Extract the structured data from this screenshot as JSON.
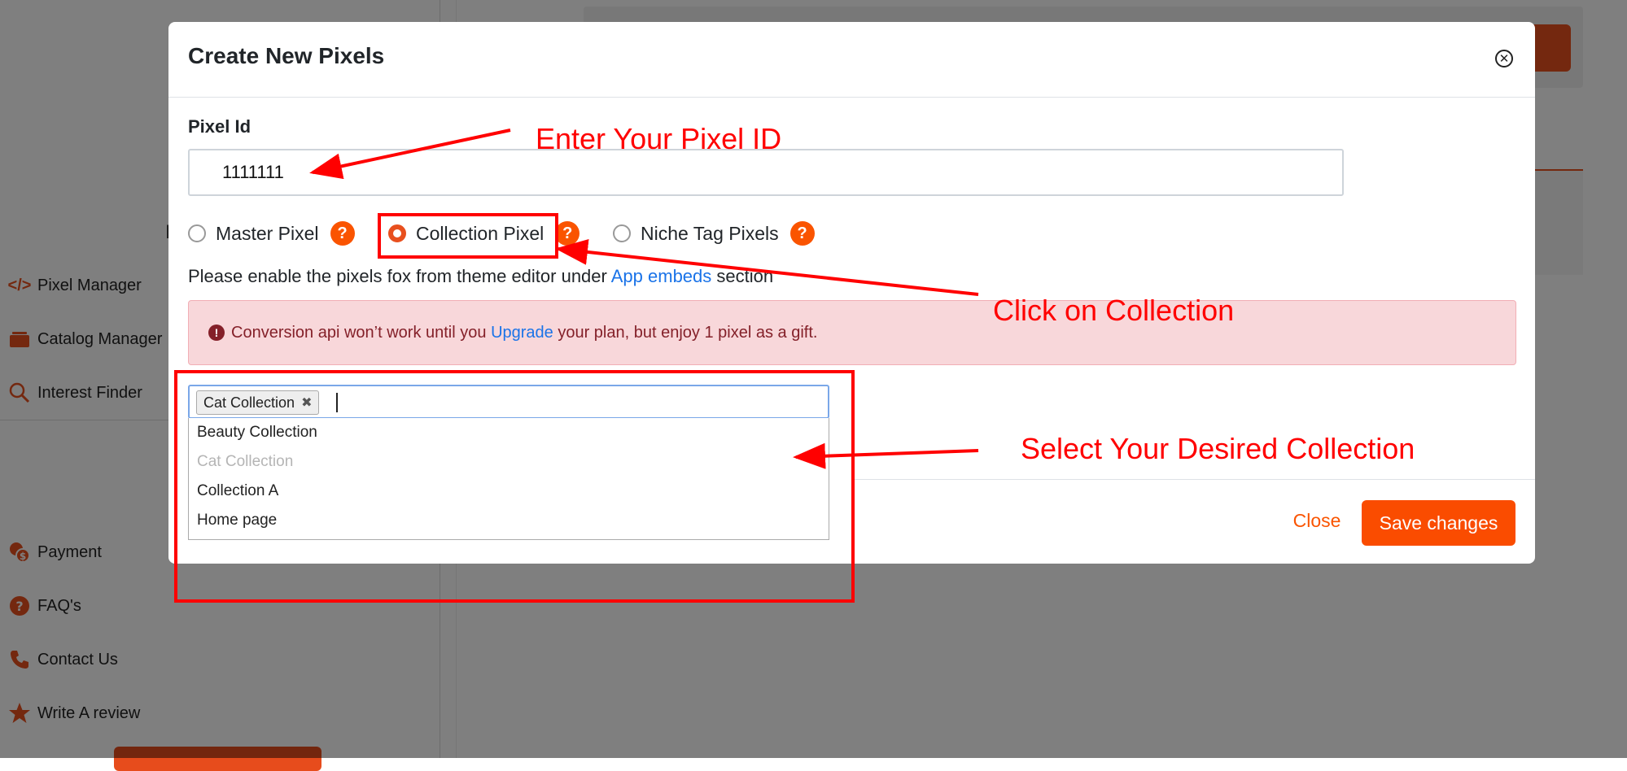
{
  "sidebar": {
    "stub": "I",
    "items": [
      {
        "label": "Pixel Manager",
        "icon": "code-icon"
      },
      {
        "label": "Catalog Manager",
        "icon": "catalog-icon"
      },
      {
        "label": "Interest Finder",
        "icon": "search-icon"
      },
      {
        "label": "Payment",
        "icon": "payment-icon"
      },
      {
        "label": "FAQ's",
        "icon": "help-icon"
      },
      {
        "label": "Contact Us",
        "icon": "phone-icon"
      },
      {
        "label": "Write A review",
        "icon": "star-icon"
      }
    ]
  },
  "modal": {
    "title": "Create New Pixels",
    "pixel_id_label": "Pixel Id",
    "pixel_id_value": "1111111",
    "radios": [
      {
        "label": "Master Pixel",
        "checked": false
      },
      {
        "label": "Collection Pixel",
        "checked": true
      },
      {
        "label": "Niche Tag Pixels",
        "checked": false
      }
    ],
    "help_glyph": "?",
    "note": {
      "before": "Please enable the pixels fox from theme editor under ",
      "link": "App embeds",
      "after": " section"
    },
    "alert": {
      "icon": "!",
      "before": "Conversion api won’t work until you ",
      "link": "Upgrade",
      "after": " your plan, but enjoy 1 pixel as a gift."
    },
    "select": {
      "selected_tag": "Cat Collection",
      "remove_glyph": "✖",
      "options": [
        {
          "label": "Beauty Collection",
          "disabled": false
        },
        {
          "label": "Cat Collection",
          "disabled": true
        },
        {
          "label": "Collection A",
          "disabled": false
        },
        {
          "label": "Home page",
          "disabled": false
        }
      ]
    },
    "close_label": "Close",
    "save_label": "Save changes",
    "close_glyph": "✕"
  },
  "annotations": {
    "enter_id": "Enter Your Pixel ID",
    "click_collection": "Click on Collection",
    "select_collection": "Select Your Desired Collection"
  },
  "colors": {
    "accent": "#fa4c00",
    "annotation": "#ff0000",
    "link": "#1a73e8",
    "alert_bg": "#f8d7da",
    "alert_text": "#842029"
  }
}
